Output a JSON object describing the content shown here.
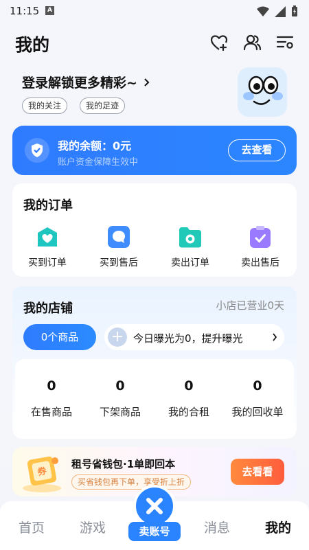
{
  "status": {
    "time": "11:15",
    "notification": "A"
  },
  "header": {
    "title": "我的"
  },
  "login": {
    "title": "登录解锁更多精彩~",
    "chips": [
      "我的关注",
      "我的足迹"
    ]
  },
  "balance": {
    "label": "我的余额：0元",
    "subtitle": "账户资金保障生效中",
    "button": "去查看"
  },
  "orders": {
    "title": "我的订单",
    "items": [
      {
        "label": "买到订单",
        "icon": "heart-bag-icon",
        "color": "#1fc6c0"
      },
      {
        "label": "买到售后",
        "icon": "chat-bubble-icon",
        "color": "#3f8cff"
      },
      {
        "label": "卖出订单",
        "icon": "folder-ring-icon",
        "color": "#21c9b8"
      },
      {
        "label": "卖出售后",
        "icon": "clipboard-check-icon",
        "color": "#9a7bff"
      }
    ]
  },
  "shop": {
    "title": "我的店铺",
    "status": "小店已营业0天",
    "goods_pill": "0个商品",
    "exposure": "今日曝光为0，提升曝光",
    "stats": [
      {
        "value": "0",
        "label": "在售商品"
      },
      {
        "value": "0",
        "label": "下架商品"
      },
      {
        "value": "0",
        "label": "我的合租"
      },
      {
        "value": "0",
        "label": "我的回收单"
      }
    ]
  },
  "promo": {
    "title": "租号省钱包·1单即回本",
    "subtitle": "买省钱包再下单，享受折上折",
    "button": "去看看"
  },
  "nav": {
    "items": [
      "首页",
      "游戏",
      "消息",
      "我的"
    ],
    "sell": "卖账号"
  }
}
